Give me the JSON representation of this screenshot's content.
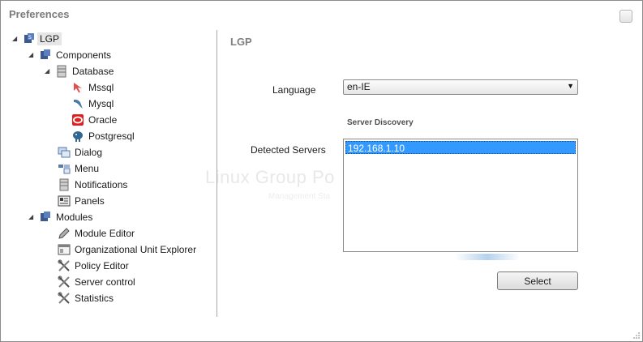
{
  "window": {
    "title": "Preferences"
  },
  "watermark": {
    "title": "Linux Group Po",
    "subtitle": "Management Sta"
  },
  "tree": {
    "root": {
      "label": "LGP",
      "icon": "lgp-icon"
    },
    "components": {
      "label": "Components",
      "icon": "lgp-icon"
    },
    "database": {
      "label": "Database",
      "icon": "database-icon"
    },
    "mssql": {
      "label": "Mssql",
      "icon": "mssql-icon"
    },
    "mysql": {
      "label": "Mysql",
      "icon": "mysql-dolphin-icon"
    },
    "oracle": {
      "label": "Oracle",
      "icon": "oracle-icon"
    },
    "postgresql": {
      "label": "Postgresql",
      "icon": "postgresql-elephant-icon"
    },
    "dialog": {
      "label": "Dialog",
      "icon": "dialog-icon"
    },
    "menu": {
      "label": "Menu",
      "icon": "menu-icon"
    },
    "notifications": {
      "label": "Notifications",
      "icon": "notifications-icon"
    },
    "panels": {
      "label": "Panels",
      "icon": "panels-icon"
    },
    "modules": {
      "label": "Modules",
      "icon": "lgp-icon"
    },
    "module_editor": {
      "label": "Module Editor",
      "icon": "pencil-icon"
    },
    "ou_explorer": {
      "label": "Organizational Unit Explorer",
      "icon": "ou-explorer-icon"
    },
    "policy_editor": {
      "label": "Policy Editor",
      "icon": "tools-icon"
    },
    "server_control": {
      "label": "Server control",
      "icon": "tools-icon"
    },
    "statistics": {
      "label": "Statistics",
      "icon": "tools-icon"
    }
  },
  "panel": {
    "title": "LGP",
    "language_label": "Language",
    "language_value": "en-IE",
    "discovery_header": "Server Discovery",
    "servers_label": "Detected Servers",
    "servers": [
      "192.168.1.10"
    ],
    "select_button": "Select"
  },
  "colors": {
    "selection": "#3399ff",
    "divider": "#a8a8a8",
    "title": "#7a7a7a"
  }
}
